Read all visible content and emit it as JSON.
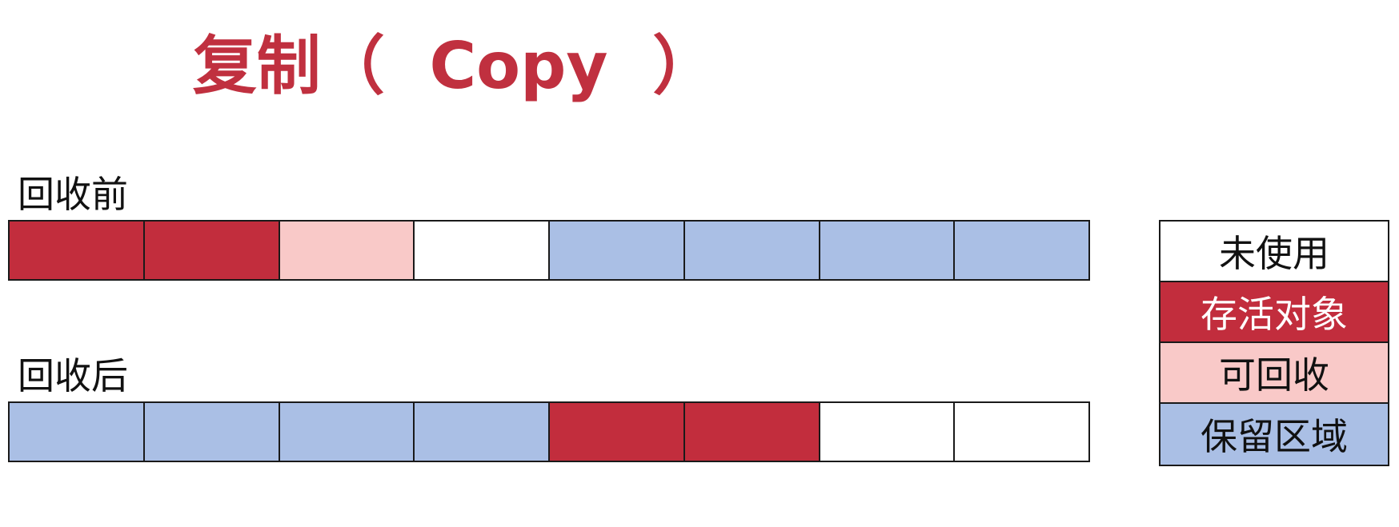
{
  "title": "复制（  Copy  ）",
  "colors": {
    "unused": "#ffffff",
    "live": "#c22d3d",
    "reclaimable": "#f9c9c8",
    "reserved": "#aabfe5"
  },
  "rows": [
    {
      "id": "before",
      "label": "回收前",
      "cells": [
        "live",
        "live",
        "reclaimable",
        "unused",
        "reserved",
        "reserved",
        "reserved",
        "reserved"
      ]
    },
    {
      "id": "after",
      "label": "回收后",
      "cells": [
        "reserved",
        "reserved",
        "reserved",
        "reserved",
        "live",
        "live",
        "unused",
        "unused"
      ]
    }
  ],
  "legend": [
    {
      "key": "unused",
      "label": "未使用",
      "text_color": "#111111"
    },
    {
      "key": "live",
      "label": "存活对象",
      "text_color": "#ffffff"
    },
    {
      "key": "reclaimable",
      "label": "可回收",
      "text_color": "#111111"
    },
    {
      "key": "reserved",
      "label": "保留区域",
      "text_color": "#111111"
    }
  ]
}
